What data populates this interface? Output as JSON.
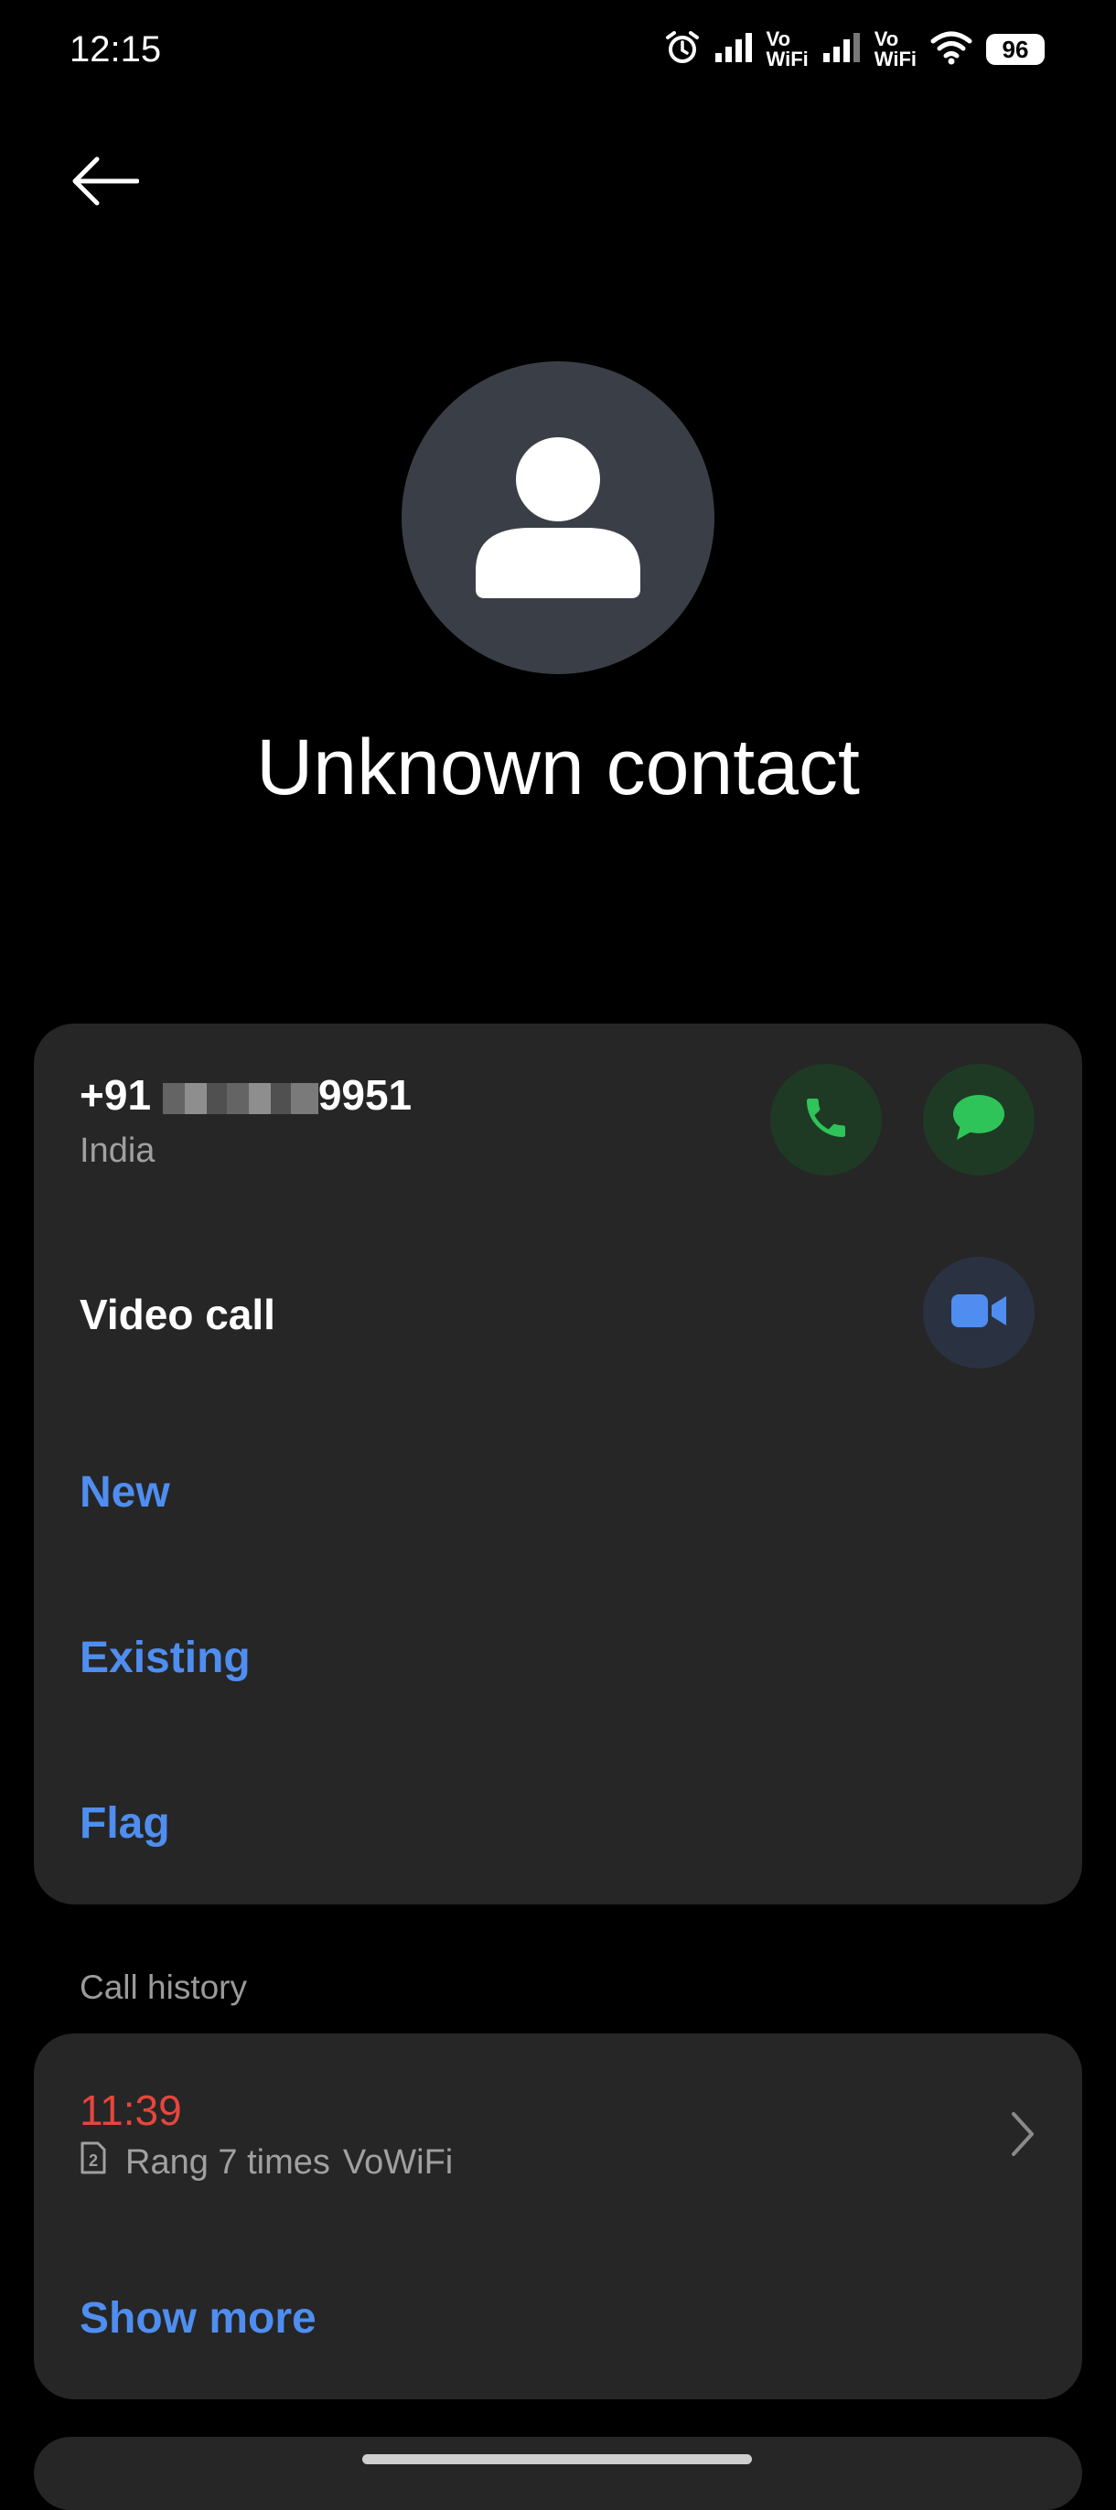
{
  "status_bar": {
    "time": "12:15",
    "vowifi_top": "Vo",
    "vowifi_bottom": "WiFi",
    "battery": "96"
  },
  "contact": {
    "name": "Unknown contact",
    "phone_prefix": "+91",
    "phone_suffix": "9951",
    "country": "India"
  },
  "actions": {
    "video_call_label": "Video call",
    "new_label": "New",
    "existing_label": "Existing",
    "flag_label": "Flag"
  },
  "call_history": {
    "section_label": "Call history",
    "entries": [
      {
        "time": "11:39",
        "detail": "Rang 7 times",
        "network": "VoWiFi",
        "sim": "2"
      }
    ],
    "show_more_label": "Show more"
  },
  "colors": {
    "accent": "#4f8ef0",
    "missed": "#e8453c",
    "call_green": "#2fc45a",
    "card_bg": "#262626",
    "avatar_bg": "#3a3f47"
  }
}
